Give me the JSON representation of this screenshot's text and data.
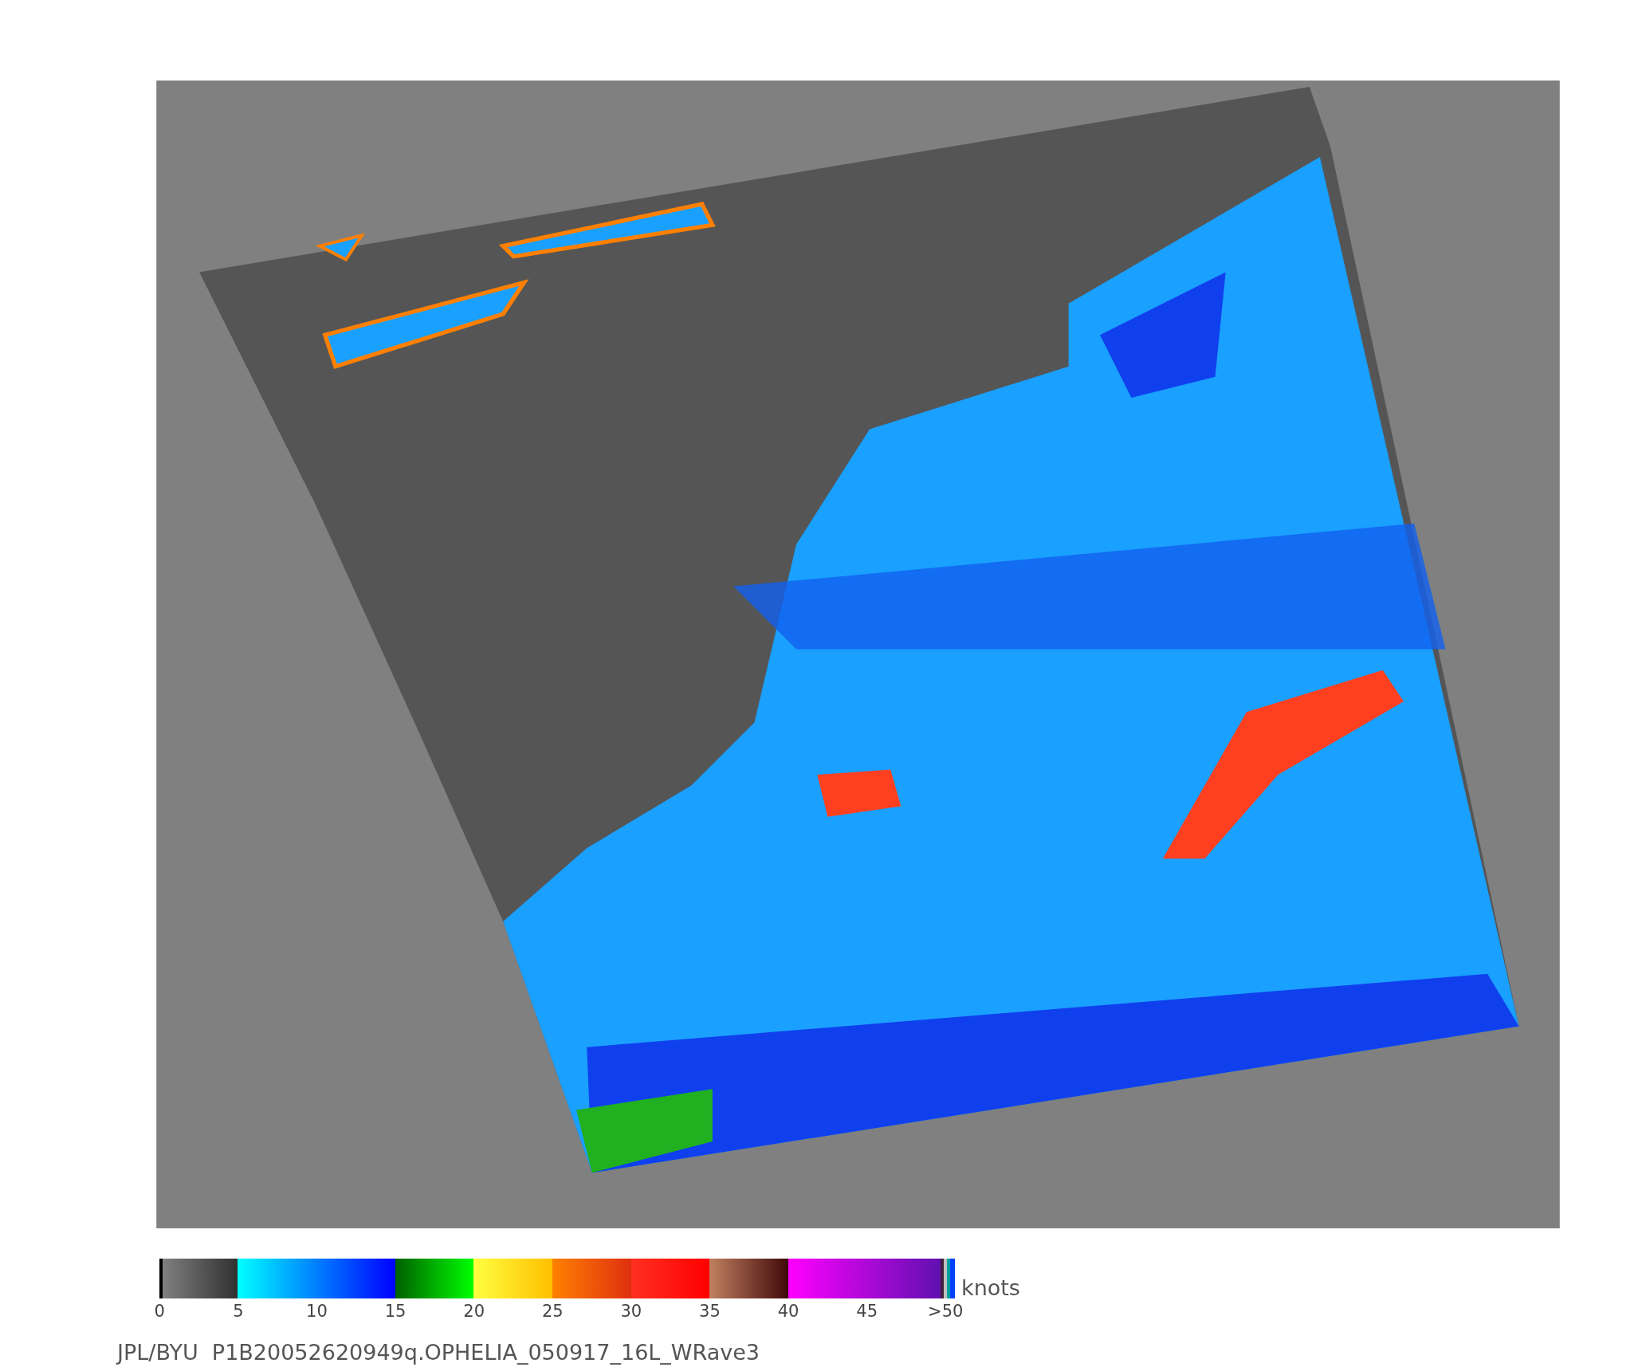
{
  "colorbar": {
    "ticks": [
      "0",
      "5",
      "10",
      "15",
      "20",
      "25",
      "30",
      "35",
      "40",
      "45",
      ">50"
    ],
    "unit": "knots"
  },
  "caption": "JPL/BYU  P1B20052620949q.OPHELIA_050917_16L_WRave3"
}
